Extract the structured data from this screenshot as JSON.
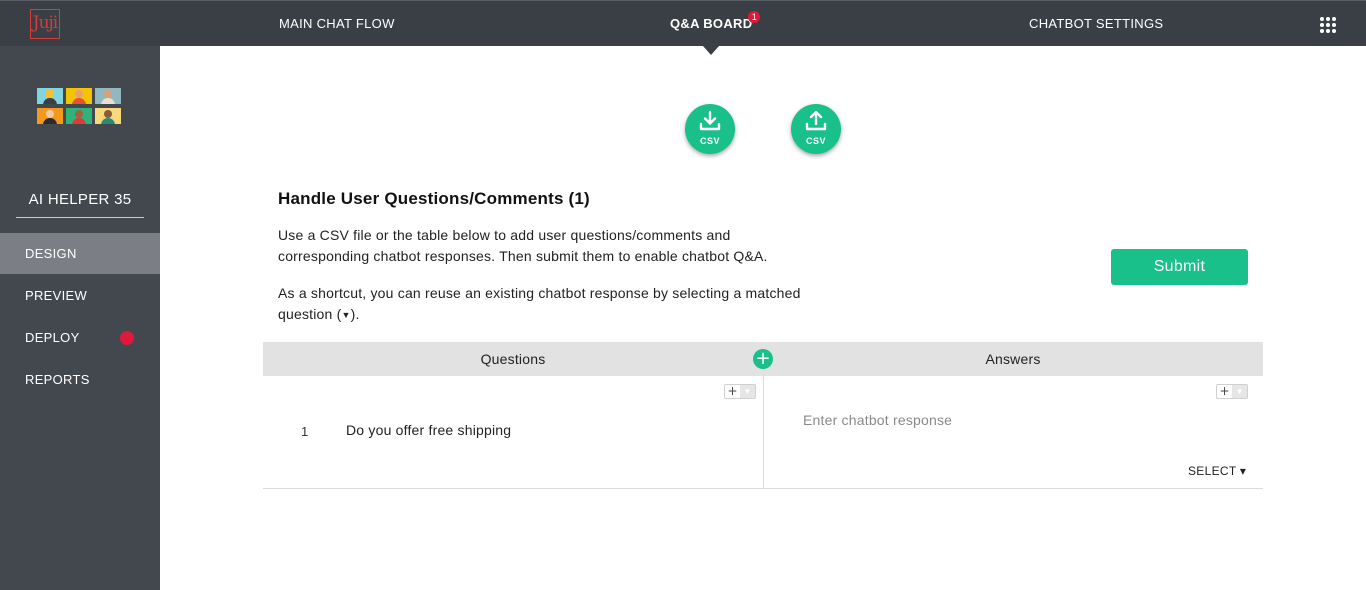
{
  "app": {
    "logo_text": "Juji"
  },
  "topnav": {
    "items": [
      {
        "label": "MAIN CHAT FLOW"
      },
      {
        "label": "Q&A BOARD",
        "badge": "1"
      },
      {
        "label": "CHATBOT SETTINGS"
      }
    ],
    "apps_icon": "grid-apps-icon"
  },
  "sidebar": {
    "bot_name": "AI HELPER 35",
    "items": [
      {
        "label": "DESIGN"
      },
      {
        "label": "PREVIEW"
      },
      {
        "label": "DEPLOY"
      },
      {
        "label": "REPORTS"
      }
    ]
  },
  "csv": {
    "download_label": "CSV",
    "upload_label": "CSV"
  },
  "main": {
    "title": "Handle User Questions/Comments (1)",
    "description_1": "Use a CSV file or the table below to add user questions/comments and corresponding chatbot responses. Then submit them to enable chatbot Q&A.",
    "description_2_prefix": "As a shortcut, you can reuse an existing chatbot response by selecting a matched question (",
    "description_2_suffix": ").",
    "submit_label": "Submit"
  },
  "table": {
    "columns": [
      "Questions",
      "Answers"
    ],
    "rows": [
      {
        "number": "1",
        "question": "Do you offer free shipping",
        "answer_placeholder": "Enter chatbot response",
        "answer_value": "",
        "select_label": "SELECT ▾"
      }
    ]
  },
  "colors": {
    "accent": "#19c08a",
    "topbar": "#3a3f46",
    "sidebar": "#43484f",
    "sidebar_active": "#7b7f85",
    "badge": "#e0193a"
  }
}
